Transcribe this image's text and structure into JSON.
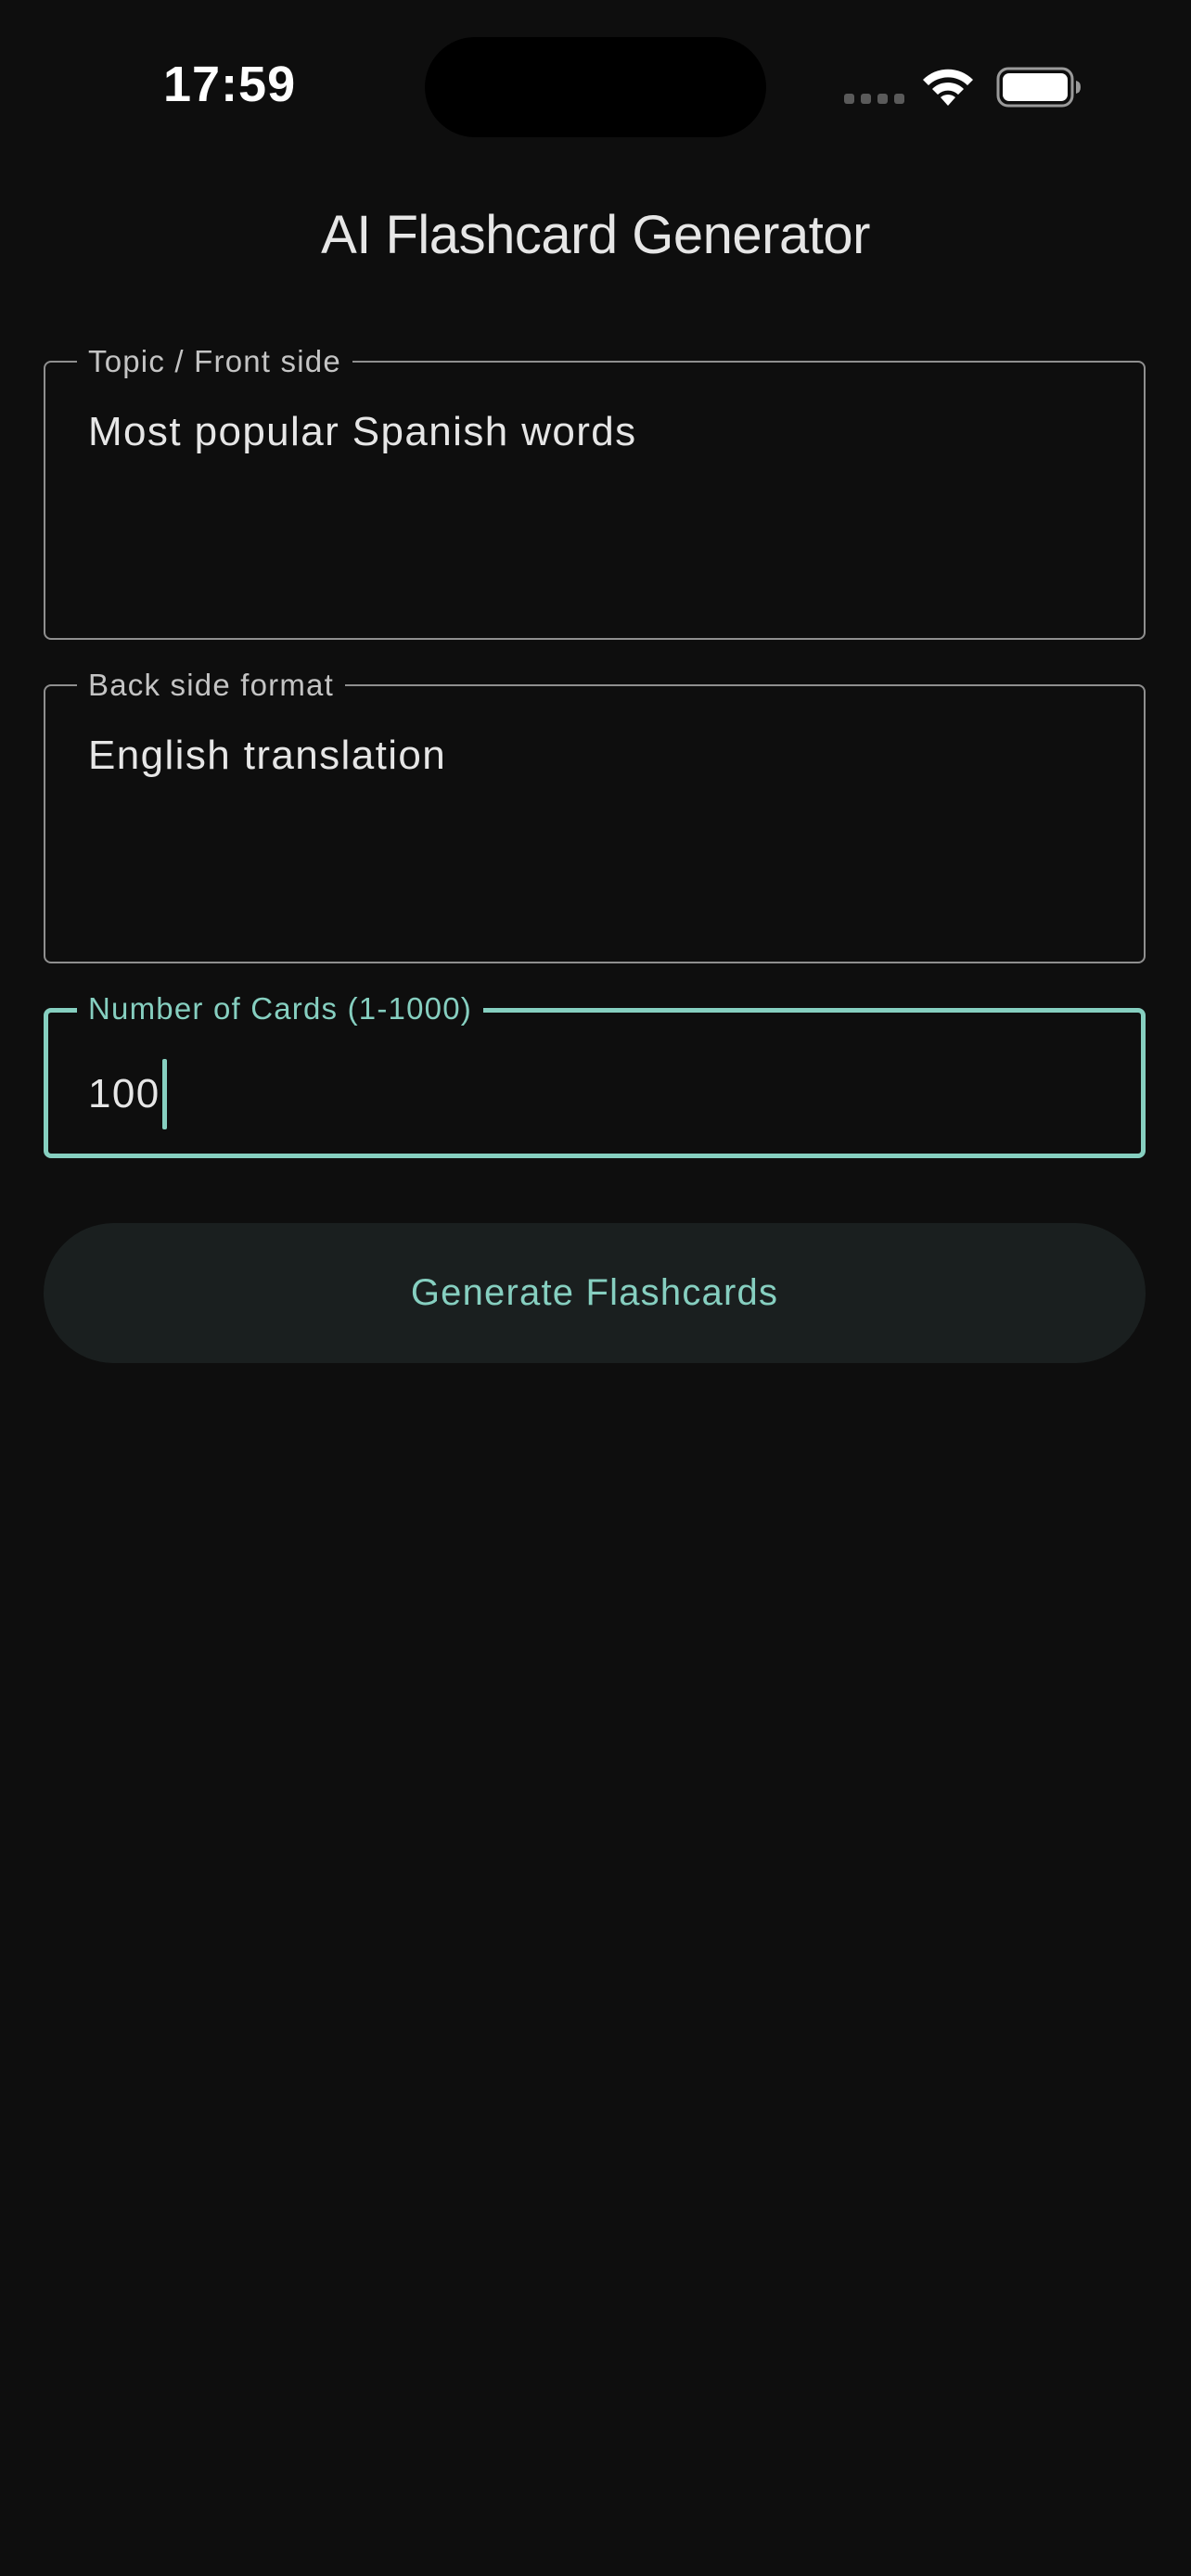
{
  "status_bar": {
    "time": "17:59"
  },
  "title": "AI Flashcard Generator",
  "form": {
    "topic": {
      "label": "Topic / Front side",
      "value": "Most popular Spanish words"
    },
    "back_format": {
      "label": "Back side format",
      "value": "English translation"
    },
    "card_count": {
      "label": "Number of Cards (1-1000)",
      "value": "100"
    }
  },
  "generate_button": {
    "label": "Generate Flashcards"
  },
  "colors": {
    "background": "#0e0e0e",
    "accent": "#86cfc0",
    "field_border": "#8f8f8f",
    "button_background": "#1a1f1f"
  },
  "icons": [
    "wifi-icon",
    "battery-icon",
    "cellular-signal-icon"
  ]
}
